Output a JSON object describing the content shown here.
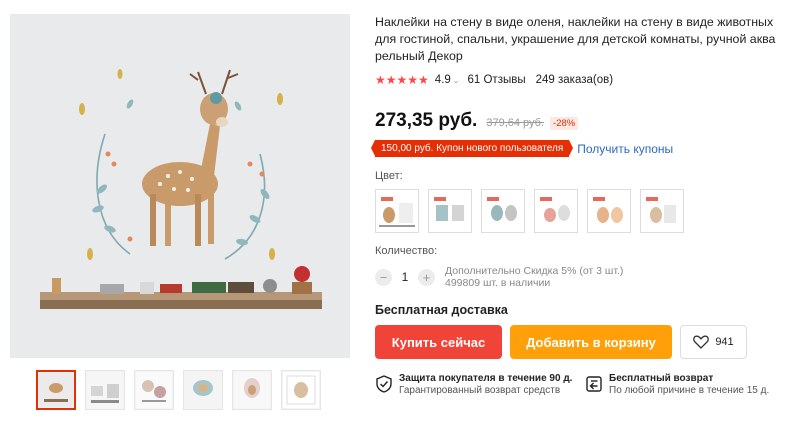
{
  "product": {
    "title": "Наклейки на стену в виде оленя, наклейки на стену в виде животных для гостиной, спальни, украшение для детской комнаты, ручной акварельный Декор",
    "stars": "★★★★★",
    "rating": "4.9",
    "rating_chevron": "⌄",
    "reviews": "61 Отзывы",
    "orders": "249 заказа(ов)",
    "price": "273,35 руб.",
    "old_price": "379,64 руб.",
    "discount": "-28%",
    "coupon": "150,00 руб. Купон нового пользователя",
    "coupon_link": "Получить купоны",
    "color_label": "Цвет:",
    "quantity_label": "Количество:",
    "quantity": "1",
    "qty_minus": "−",
    "qty_plus": "+",
    "stock_line1": "Дополнительно Скидка 5% (от 3 шт.)",
    "stock_line2": "499809 шт. в наличии",
    "shipping": "Бесплатная доставка",
    "buy_now": "Купить сейчас",
    "add_to_cart": "Добавить в корзину",
    "wishlist_count": "941",
    "guarantee_title": "Защита покупателя в течение 90 д.",
    "guarantee_sub": "Гарантированный возврат средств",
    "return_title": "Бесплатный возврат",
    "return_sub": "По любой причине в течение 15 д."
  },
  "icons": {
    "heart": "heart-icon",
    "shield": "shield-check-icon",
    "return": "return-icon"
  },
  "colors": {
    "accent_red": "#f04438",
    "accent_orange": "#ff9f0a",
    "star_red": "#ff4747",
    "coupon_red": "#e62e04",
    "link_blue": "#2e6ac2"
  }
}
